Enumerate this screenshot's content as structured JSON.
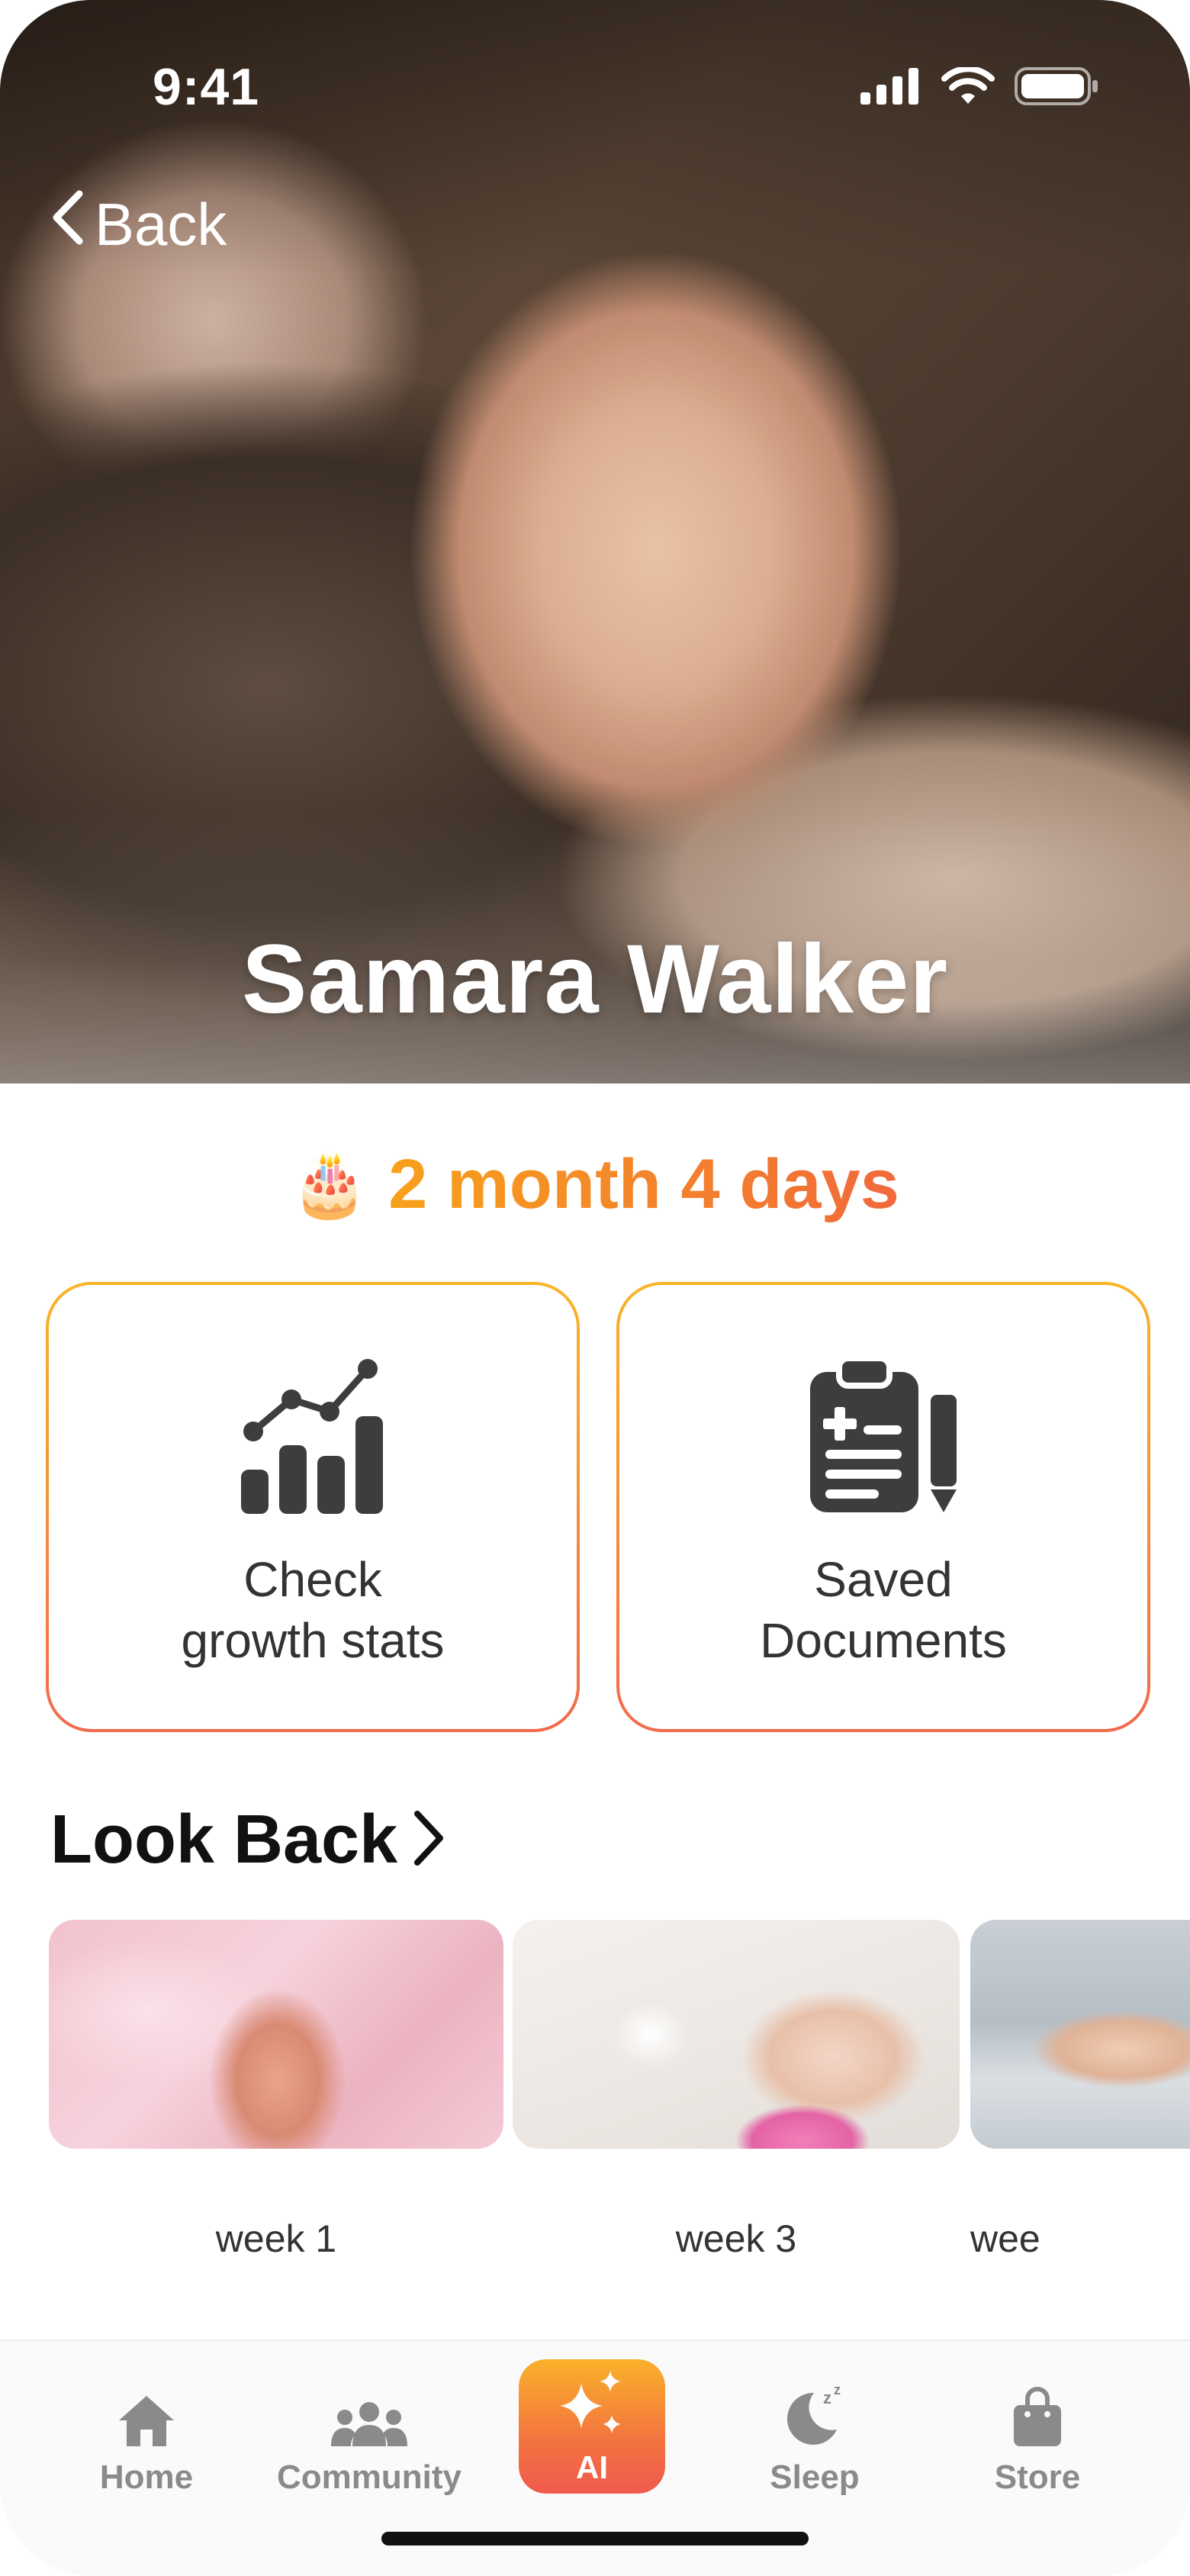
{
  "status_bar": {
    "time": "9:41"
  },
  "header": {
    "back_label": "Back"
  },
  "profile": {
    "name": "Samara Walker",
    "age_emoji": "🎂",
    "age": "2 month 4 days"
  },
  "cards": [
    {
      "label_line1": "Check",
      "label_line2": "growth stats",
      "icon": "growth-chart-icon"
    },
    {
      "label_line1": "Saved",
      "label_line2": "Documents",
      "icon": "clipboard-document-icon"
    }
  ],
  "look_back": {
    "title": "Look Back",
    "items": [
      {
        "label": "week 1"
      },
      {
        "label": "week 3"
      },
      {
        "label": "wee"
      }
    ]
  },
  "tabbar": {
    "items": [
      {
        "label": "Home",
        "icon": "home-icon"
      },
      {
        "label": "Community",
        "icon": "community-icon"
      },
      {
        "label": "AI",
        "icon": "sparkle-icon",
        "active": true
      },
      {
        "label": "Sleep",
        "icon": "moon-sleep-icon"
      },
      {
        "label": "Store",
        "icon": "shopping-bag-icon"
      }
    ]
  },
  "colors": {
    "accent_start": "#f9b12a",
    "accent_end": "#ef5a4d",
    "age_text_start": "#f7a11a",
    "age_text_end": "#f1693b",
    "icon_dark": "#3d3d3d",
    "tab_inactive": "#8a8a8a"
  }
}
